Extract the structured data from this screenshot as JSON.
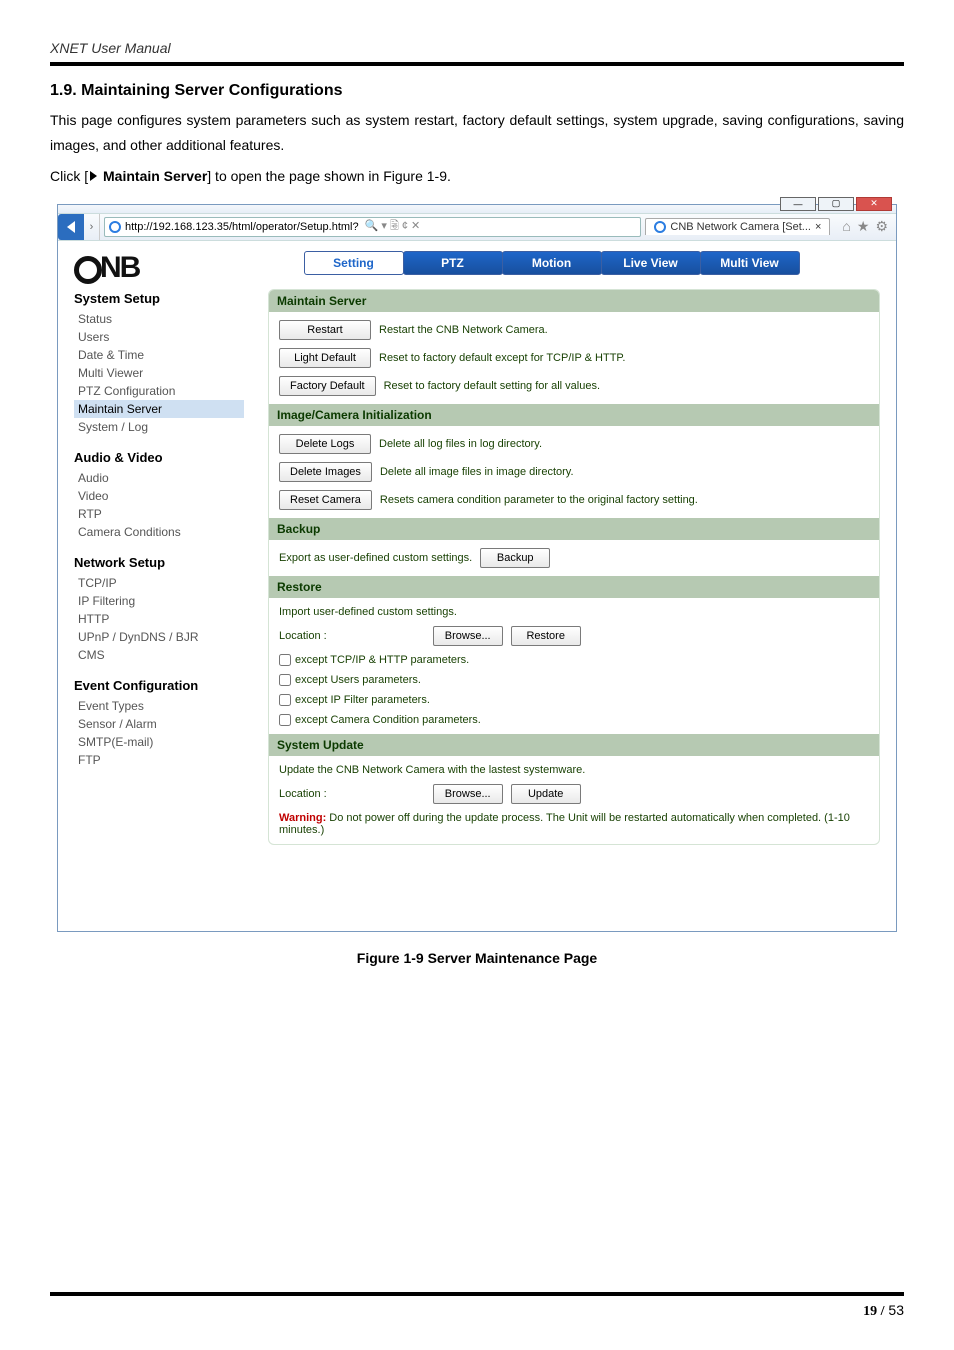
{
  "doc": {
    "running_title": "XNET User Manual"
  },
  "section": {
    "heading": "1.9. Maintaining Server Configurations",
    "para1": "This page configures system parameters such as system restart, factory default settings, system upgrade, saving configurations, saving images, and other additional features.",
    "para2_pre": "Click [",
    "para2_link": " Maintain Server",
    "para2_post": "] to open the page shown in Figure 1-9."
  },
  "browser": {
    "url": "http://192.168.123.35/html/operator/Setup.html?",
    "url_suffix_icons": "🔍 ▾  🗟 ¢ ✕",
    "tab_title": "CNB Network Camera [Set...",
    "tab_close": "×",
    "win_min": "—",
    "win_max": "▢",
    "win_close": "✕",
    "home_icon": "⌂",
    "star_icon": "★",
    "gear_icon": "⚙"
  },
  "logo_text": "NB",
  "nav": {
    "setting": "Setting",
    "ptz": "PTZ",
    "motion": "Motion",
    "live": "Live View",
    "multi": "Multi View"
  },
  "menu": {
    "g1": "System Setup",
    "g1_items": [
      "Status",
      "Users",
      "Date & Time",
      "Multi Viewer",
      "PTZ Configuration",
      "Maintain Server",
      "System / Log"
    ],
    "g2": "Audio & Video",
    "g2_items": [
      "Audio",
      "Video",
      "RTP",
      "Camera Conditions"
    ],
    "g3": "Network Setup",
    "g3_items": [
      "TCP/IP",
      "IP Filtering",
      "HTTP",
      "UPnP / DynDNS / BJR",
      "CMS"
    ],
    "g4": "Event Configuration",
    "g4_items": [
      "Event Types",
      "Sensor / Alarm",
      "SMTP(E-mail)",
      "FTP"
    ]
  },
  "pane": {
    "s1_title": "Maintain Server",
    "btn_restart": "Restart",
    "d_restart": "Restart the CNB Network Camera.",
    "btn_light": "Light Default",
    "d_light": "Reset to factory default except for TCP/IP & HTTP.",
    "btn_factory": "Factory Default",
    "d_factory": "Reset to factory default setting for all values.",
    "s2_title": "Image/Camera Initialization",
    "btn_dellogs": "Delete Logs",
    "d_dellogs": "Delete all log files in log directory.",
    "btn_delimg": "Delete Images",
    "d_delimg": "Delete all image files in image directory.",
    "btn_resetcam": "Reset Camera",
    "d_resetcam": "Resets camera condition parameter to the original factory setting.",
    "s3_title": "Backup",
    "d_backup": "Export as user-defined custom settings.",
    "btn_backup": "Backup",
    "s4_title": "Restore",
    "d_restore_top": "Import user-defined custom settings.",
    "lbl_location": "Location :",
    "btn_browse": "Browse...",
    "btn_restore": "Restore",
    "chk1": "except TCP/IP & HTTP parameters.",
    "chk2": "except Users parameters.",
    "chk3": "except IP Filter parameters.",
    "chk4": "except Camera Condition parameters.",
    "s5_title": "System Update",
    "d_update_top": "Update the CNB Network Camera with the lastest systemware.",
    "btn_update": "Update",
    "warn_b": "Warning:",
    "warn_rest": "  Do not power off during the update process.  The Unit will be restarted automatically when completed. (1-10 minutes.)"
  },
  "figure_caption": "Figure 1-9 Server Maintenance Page",
  "footer": {
    "page_bold": "19 /",
    "page_total": " 53"
  }
}
